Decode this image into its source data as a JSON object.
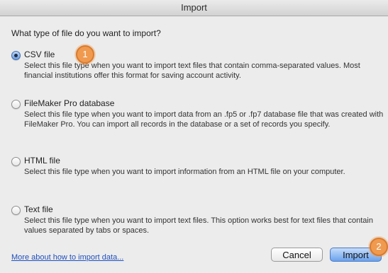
{
  "window": {
    "title": "Import"
  },
  "question": "What type of file do you want to import?",
  "options": [
    {
      "label": "CSV file",
      "selected": true,
      "description": "Select this file type when you want to import text files that contain comma-separated values. Most financial institutions offer this format for saving account activity."
    },
    {
      "label": "FileMaker Pro database",
      "selected": false,
      "description": "Select this file type when you want to import data from an .fp5 or .fp7 database file that was created with FileMaker Pro.  You can import all records in the database or a set of records you specify."
    },
    {
      "label": "HTML file",
      "selected": false,
      "description": "Select this file type when you want to import information from an HTML file on your computer."
    },
    {
      "label": "Text file",
      "selected": false,
      "description": "Select this file type when you want to import text files.  This option works best for text files that contain values separated by tabs or spaces."
    }
  ],
  "help_link": "More about how to import data...",
  "buttons": {
    "cancel": "Cancel",
    "import": "Import"
  },
  "markers": {
    "first": "1",
    "second": "2"
  },
  "colors": {
    "marker": "#f09a4f",
    "link": "#1f4fbf",
    "default_button": "#6aa2ee"
  }
}
